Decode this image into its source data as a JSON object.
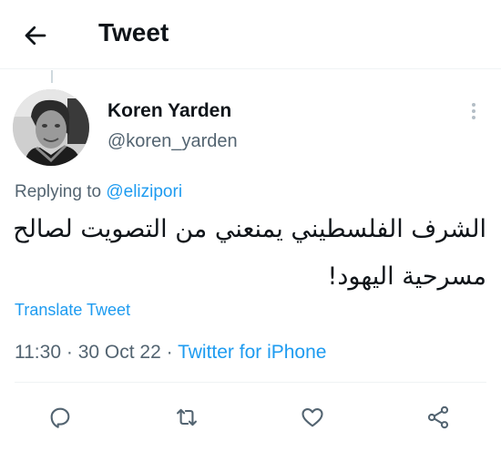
{
  "header": {
    "title": "Tweet",
    "back_icon": "arrow-left-icon"
  },
  "tweet": {
    "author": {
      "display_name": "Koren Yarden",
      "handle": "@koren_yarden"
    },
    "replying_prefix": "Replying to ",
    "replying_to": "@elizipori",
    "text": "الشرف الفلسطيني يمنعني من التصويت لصالح مسرحية اليهود!",
    "translate_label": "Translate Tweet",
    "time": "11:30",
    "date": "30 Oct 22",
    "separator": "·",
    "source": "Twitter for iPhone"
  },
  "actions": [
    {
      "name": "reply",
      "icon": "reply-icon"
    },
    {
      "name": "retweet",
      "icon": "retweet-icon"
    },
    {
      "name": "like",
      "icon": "heart-icon"
    },
    {
      "name": "share",
      "icon": "share-icon"
    }
  ],
  "colors": {
    "accent": "#1d9bf0",
    "secondary_text": "#536471",
    "primary_text": "#0f1419",
    "divider": "#eff3f4"
  }
}
